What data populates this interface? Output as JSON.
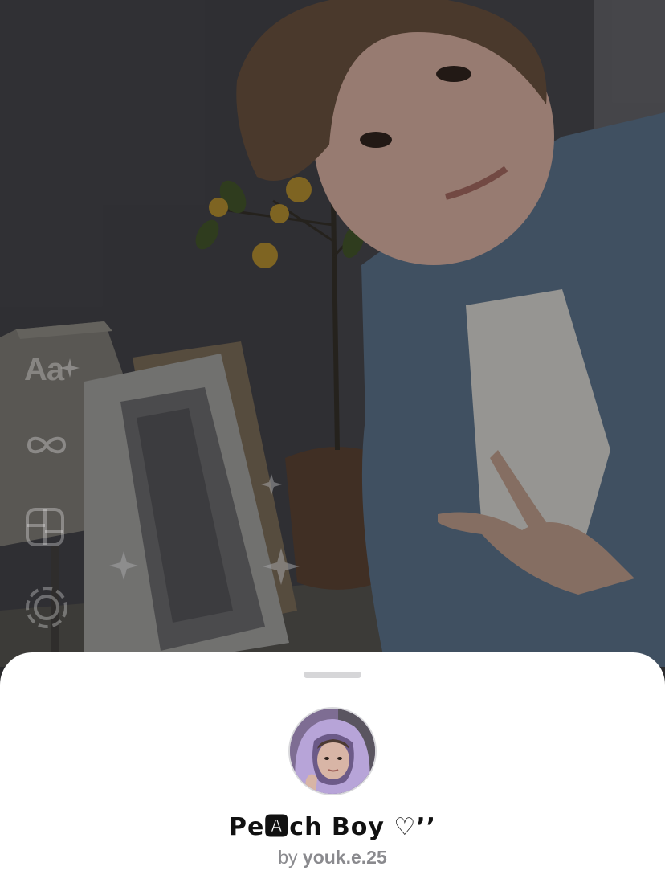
{
  "toolbar": {
    "text_tool_label": "Aa",
    "items": [
      {
        "name": "text-tool",
        "icon": "text-icon"
      },
      {
        "name": "boomerang-tool",
        "icon": "infinity-icon"
      },
      {
        "name": "layout-tool",
        "icon": "layout-grid-icon"
      },
      {
        "name": "capture-tool",
        "icon": "dashed-circle-icon"
      }
    ]
  },
  "effect_sheet": {
    "effect_name": "Pe🅰ch Boy ♡’’",
    "creator_prefix": "by",
    "creator_handle": "youk.e.25"
  },
  "colors": {
    "sheet_background": "#ffffff",
    "title_text": "#111111",
    "secondary_text": "#8a8a8e",
    "grabber": "#d6d6d8"
  }
}
